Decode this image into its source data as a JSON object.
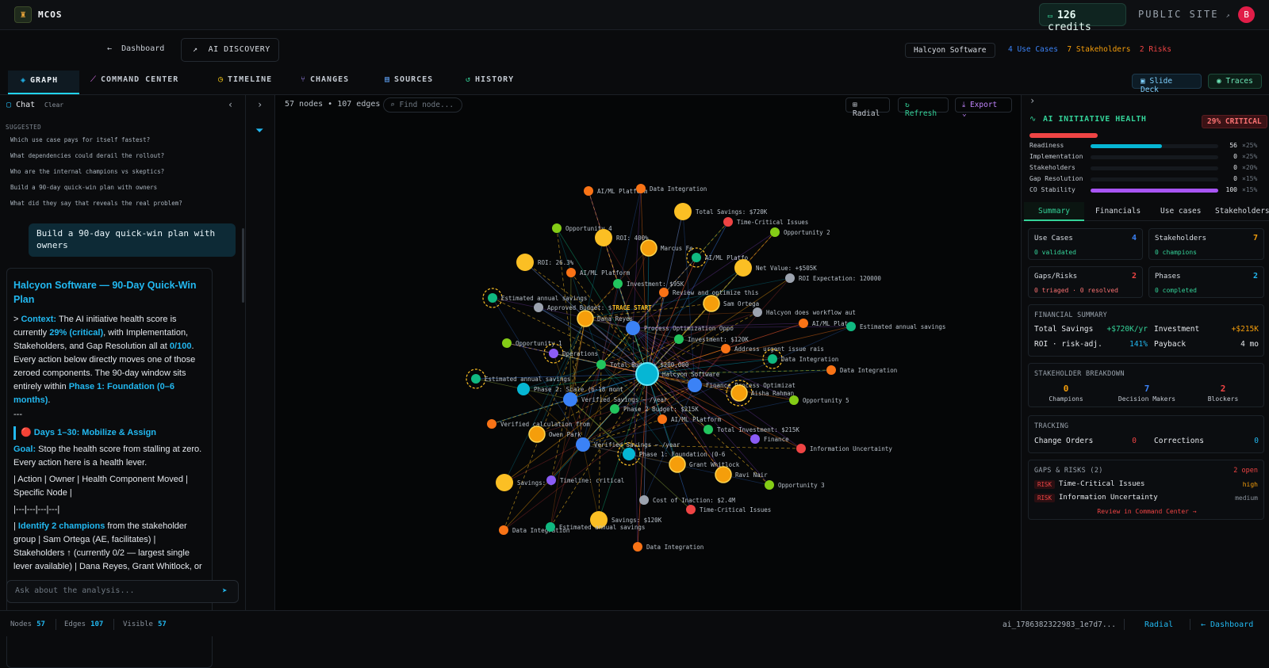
{
  "app": {
    "name": "MCOS",
    "credits_value": "126",
    "credits_label": "credits",
    "public_site": "PUBLIC SITE",
    "avatar_initial": "B"
  },
  "subheader": {
    "back_label": "Dashboard",
    "section_label": "AI DISCOVERY",
    "company": "Halcyon Software",
    "use_cases": "4 Use Cases",
    "stakeholders": "7 Stakeholders",
    "risks": "2 Risks"
  },
  "tabs": [
    {
      "label": "GRAPH",
      "icon": "layers-icon"
    },
    {
      "label": "COMMAND CENTER",
      "icon": "wand-icon"
    },
    {
      "label": "TIMELINE",
      "icon": "clock-icon"
    },
    {
      "label": "CHANGES",
      "icon": "branch-icon"
    },
    {
      "label": "SOURCES",
      "icon": "document-icon"
    },
    {
      "label": "HISTORY",
      "icon": "history-icon"
    }
  ],
  "right_buttons": {
    "slide_deck": "Slide Deck",
    "traces": "Traces"
  },
  "chat": {
    "title": "Chat",
    "clear": "Clear",
    "suggested_label": "SUGGESTED",
    "suggestions": [
      "Which use case pays for itself fastest?",
      "What dependencies could derail the rollout?",
      "Who are the internal champions vs skeptics?",
      "Build a 90-day quick-win plan with owners",
      "What did they say that reveals the real problem?"
    ],
    "user_message": "Build a 90-day quick-win plan with owners",
    "response": {
      "title": "Halcyon Software — 90-Day Quick-Win Plan",
      "p1_a": "> ",
      "p1_context": "Context:",
      "p1_b": " The AI initiative health score is currently ",
      "p1_score": "29% (critical)",
      "p1_c": ", with Implementation, Stakeholders, and Gap Resolution all at ",
      "p1_zero": "0/100",
      "p1_d": ". Every action below directly moves one of those zeroed components. The 90-day window sits entirely within ",
      "p1_phase": "Phase 1: Foundation (0–6 months)",
      "p1_e": ".",
      "divider": "---",
      "days_head": "🔴 Days 1–30: Mobilize & Assign",
      "goal_label": "Goal:",
      "goal_text": " Stop the health score from stalling at zero. Every action here is a health lever.",
      "table_head": "| Action | Owner | Health Component Moved | Specific Node |",
      "table_sep": "|---|---|---|---|",
      "row_a": "| ",
      "row_hl": "Identify 2 champions",
      "row_b": " from the stakeholder group | Sam Ortega (AE, facilitates) | Stakeholders ↑ (currently 0/2 — largest single lever available) | Dana Reyes, Grant Whitlock, or"
    },
    "input_placeholder": "Ask about the analysis..."
  },
  "graph": {
    "stats": "57 nodes • 107 edges",
    "find_placeholder": "Find node...",
    "layout_btn": "Radial",
    "refresh_btn": "Refresh",
    "export_btn": "Export",
    "trace_start": "TRACE START",
    "nodes": [
      {
        "label": "AI/ML Platform",
        "type": "source"
      },
      {
        "label": "Data Integration",
        "type": "source"
      },
      {
        "label": "Total Savings: $720K",
        "type": "value"
      },
      {
        "label": "Time-Critical Issues",
        "type": "risk"
      },
      {
        "label": "Opportunity 4",
        "type": "opportunity"
      },
      {
        "label": "ROI: 400%",
        "type": "value"
      },
      {
        "label": "Marcus Fe",
        "type": "person"
      },
      {
        "label": "AI/ML Platfo",
        "type": "usecase"
      },
      {
        "label": "Opportunity 2",
        "type": "opportunity"
      },
      {
        "label": "ROI: 26.3%",
        "type": "value"
      },
      {
        "label": "AI/ML Platform",
        "type": "source"
      },
      {
        "label": "Net Value: +$505K",
        "type": "value"
      },
      {
        "label": "ROI Expectation: 120000",
        "type": "doc"
      },
      {
        "label": "Investment: $95K",
        "type": "money"
      },
      {
        "label": "Review and optimize this",
        "type": "source"
      },
      {
        "label": "Estimated annual savings",
        "type": "usecase"
      },
      {
        "label": "Approved Budget: $",
        "type": "doc"
      },
      {
        "label": "Dana Reyes",
        "type": "person"
      },
      {
        "label": "Process Optimization Oppo",
        "type": "hub"
      },
      {
        "label": "Sam Ortega",
        "type": "person"
      },
      {
        "label": "Halcyon does workflow aut",
        "type": "doc"
      },
      {
        "label": "AI/ML Plat",
        "type": "source"
      },
      {
        "label": "Estimated annual savings",
        "type": "usecase"
      },
      {
        "label": "Opportunity 1",
        "type": "opportunity"
      },
      {
        "label": "Investment: $120K",
        "type": "money"
      },
      {
        "label": "Operations",
        "type": "dept"
      },
      {
        "label": "Address urgent issue rais",
        "type": "source"
      },
      {
        "label": "Data Integration",
        "type": "usecase"
      },
      {
        "label": "Total Budget: $200,000",
        "type": "money"
      },
      {
        "label": "Halcyon Software",
        "type": "center"
      },
      {
        "label": "Data Integration",
        "type": "source"
      },
      {
        "label": "Estimated annual savings",
        "type": "usecase"
      },
      {
        "label": "Phase 2: Scale (6-18 mont",
        "type": "phase"
      },
      {
        "label": "Finance Process Optimizat",
        "type": "hub"
      },
      {
        "label": "Verified Savings ~ /year",
        "type": "hub"
      },
      {
        "label": "Aisha Rahman",
        "type": "person"
      },
      {
        "label": "Opportunity 5",
        "type": "opportunity"
      },
      {
        "label": "Phase 2 Budget: $215K",
        "type": "money"
      },
      {
        "label": "Verified calculation from",
        "type": "source"
      },
      {
        "label": "AI/ML Platform",
        "type": "source"
      },
      {
        "label": "Owen Park",
        "type": "person"
      },
      {
        "label": "Total Investment: $215K",
        "type": "money"
      },
      {
        "label": "Finance",
        "type": "dept"
      },
      {
        "label": "Information Uncertainty",
        "type": "risk"
      },
      {
        "label": "Verified Savings ~ /year",
        "type": "hub"
      },
      {
        "label": "Phase 1: Foundation (0-6",
        "type": "phase"
      },
      {
        "label": "Grant Whitlock",
        "type": "person"
      },
      {
        "label": "Savings: $",
        "type": "value"
      },
      {
        "label": "Timeline: critical",
        "type": "dept"
      },
      {
        "label": "Ravi Nair",
        "type": "person"
      },
      {
        "label": "Opportunity 3",
        "type": "opportunity"
      },
      {
        "label": "Cost of Inaction: $2.4M",
        "type": "doc"
      },
      {
        "label": "Time-Critical Issues",
        "type": "risk"
      },
      {
        "label": "Savings: $120K",
        "type": "value"
      },
      {
        "label": "Data Integration",
        "type": "source"
      },
      {
        "label": "Estimated annual savings",
        "type": "usecase"
      },
      {
        "label": "Data Integration",
        "type": "source"
      }
    ]
  },
  "health": {
    "title": "AI INITIATIVE HEALTH",
    "badge": "29% CRITICAL",
    "score": 0.29,
    "rows": [
      {
        "label": "Readiness",
        "value": "56",
        "weight": "×25%",
        "level": 0.56,
        "color": "#06b6d4"
      },
      {
        "label": "Implementation",
        "value": "0",
        "weight": "×25%",
        "level": 0,
        "color": "#06b6d4"
      },
      {
        "label": "Stakeholders",
        "value": "0",
        "weight": "×20%",
        "level": 0,
        "color": "#06b6d4"
      },
      {
        "label": "Gap Resolution",
        "value": "0",
        "weight": "×15%",
        "level": 0,
        "color": "#06b6d4"
      },
      {
        "label": "CO Stability",
        "value": "100",
        "weight": "×15%",
        "level": 1.0,
        "color": "#a855f7"
      }
    ]
  },
  "right_tabs": [
    "Summary",
    "Financials",
    "Use cases",
    "Stakeholders"
  ],
  "summary": {
    "use_cases": {
      "title": "Use Cases",
      "count": "4",
      "sub": "0 validated"
    },
    "stakeholders": {
      "title": "Stakeholders",
      "count": "7",
      "sub": "0 champions"
    },
    "gaps": {
      "title": "Gaps/Risks",
      "count": "2",
      "sub": "0 triaged · 0 resolved"
    },
    "phases": {
      "title": "Phases",
      "count": "2",
      "sub": "0 completed"
    },
    "financial": {
      "label": "FINANCIAL SUMMARY",
      "total_savings_label": "Total Savings",
      "total_savings": "+$720K/yr",
      "investment_label": "Investment",
      "investment": "+$215K",
      "roi_label": "ROI · risk-adj.",
      "roi": "141%",
      "payback_label": "Payback",
      "payback": "4 mo"
    },
    "stakeholder_breakdown": {
      "label": "STAKEHOLDER BREAKDOWN",
      "champions_n": "0",
      "champions": "Champions",
      "decision_n": "7",
      "decision": "Decision Makers",
      "blockers_n": "2",
      "blockers": "Blockers"
    },
    "tracking": {
      "label": "TRACKING",
      "change_orders": "Change Orders",
      "change_orders_n": "0",
      "corrections": "Corrections",
      "corrections_n": "0"
    },
    "gaps_risks": {
      "label": "GAPS & RISKS (2)",
      "open": "2 open",
      "items": [
        {
          "tag": "RISK",
          "title": "Time-Critical Issues",
          "level": "high"
        },
        {
          "tag": "RISK",
          "title": "Information Uncertainty",
          "level": "medium"
        }
      ],
      "link": "Review in Command Center →"
    }
  },
  "status": {
    "nodes_label": "Nodes",
    "nodes": "57",
    "edges_label": "Edges",
    "edges": "107",
    "visible_label": "Visible",
    "visible": "57",
    "session_id": "ai_1786382322983_1e7d7...",
    "layout": "Radial",
    "dashboard": "← Dashboard"
  },
  "colors": {
    "accent": "#22b8f0",
    "success": "#34d399",
    "danger": "#ef4444",
    "warning": "#f59e0b",
    "purple": "#a855f7"
  }
}
